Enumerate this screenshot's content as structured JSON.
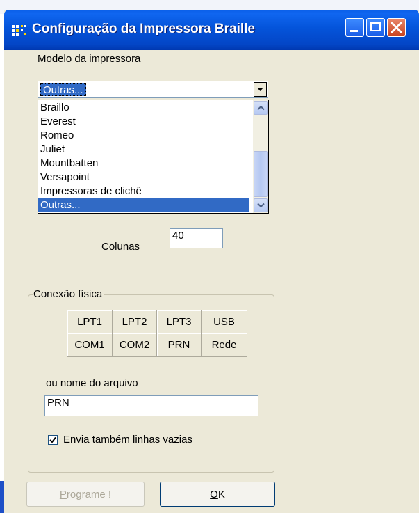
{
  "window": {
    "title": "Configuração da Impressora Braille",
    "controls": [
      "minimize-icon",
      "maximize-icon",
      "close-icon"
    ]
  },
  "printer_model": {
    "label": "Modelo da impressora",
    "selected": "Outras...",
    "options": [
      "Braillo",
      "Everest",
      "Romeo",
      "Juliet",
      "Mountbatten",
      "Versapoint",
      "Impressoras de clichê",
      "Outras..."
    ],
    "selected_index": 7
  },
  "columns": {
    "label_accel": "C",
    "label_rest": "olunas",
    "value": "40"
  },
  "connection": {
    "title": "Conexão física",
    "ports": [
      "LPT1",
      "LPT2",
      "LPT3",
      "USB",
      "COM1",
      "COM2",
      "PRN",
      "Rede"
    ],
    "filename_label": "ou nome do arquivo",
    "filename_value": "PRN",
    "send_empty_lines": {
      "label": "Envia também linhas vazias",
      "checked": true
    }
  },
  "buttons": {
    "program": {
      "accel": "P",
      "rest": "rograme !",
      "enabled": false
    },
    "ok": {
      "accel": "O",
      "rest": "K",
      "enabled": true
    }
  },
  "colors": {
    "titlebar": "#0454da",
    "selection": "#316ac5",
    "dialog_bg": "#ece9d8"
  }
}
